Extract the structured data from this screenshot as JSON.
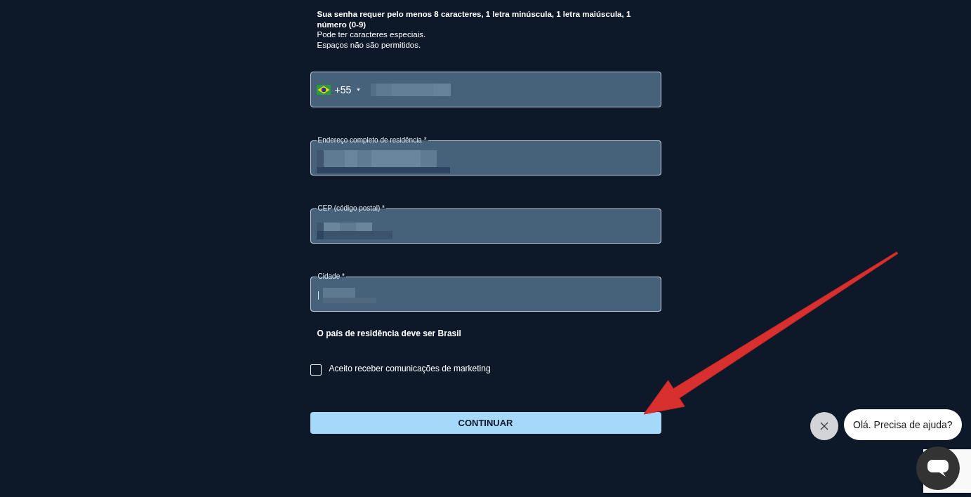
{
  "password_hint": {
    "requirements": "Sua senha requer pelo menos 8 caracteres, 1 letra minúscula, 1 letra maiúscula, 1 número (0-9)",
    "notes": [
      "Pode ter caracteres especiais.",
      "Espaços não são permitidos."
    ]
  },
  "fields": [
    {
      "kind": "phone",
      "country_code": "+55",
      "redacted": true
    },
    {
      "kind": "text",
      "label": "Endereço completo de residência *",
      "redacted": true,
      "focused": false
    },
    {
      "kind": "text",
      "label": "CEP (código postal) *",
      "redacted": true,
      "focused": false
    },
    {
      "kind": "text",
      "label": "Cidade *",
      "redacted": true,
      "focused": true
    }
  ],
  "country_note": "O país de residência deve ser Brasil",
  "marketing_consent": {
    "label": "Aceito receber comunicações de marketing",
    "checked": false
  },
  "submit_button": "CONTINUAR",
  "chat_widget": {
    "greeting": "Olá. Precisa de ajuda?"
  }
}
